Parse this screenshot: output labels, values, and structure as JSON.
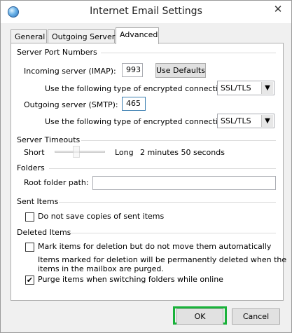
{
  "window": {
    "title": "Internet Email Settings",
    "close_glyph": "✕"
  },
  "tabs": [
    {
      "label": "General"
    },
    {
      "label": "Outgoing Server"
    },
    {
      "label": "Advanced"
    }
  ],
  "server_ports": {
    "heading": "Server Port Numbers",
    "incoming_label": "Incoming server (IMAP):",
    "incoming_value": "993",
    "use_defaults_label": "Use Defaults",
    "encryption_label": "Use the following type of encrypted connection:",
    "incoming_encryption": "SSL/TLS",
    "outgoing_label": "Outgoing server (SMTP):",
    "outgoing_value": "465",
    "outgoing_encryption": "SSL/TLS"
  },
  "timeouts": {
    "heading": "Server Timeouts",
    "short_label": "Short",
    "long_label": "Long",
    "value_text": "2 minutes 50 seconds",
    "level": 0.4
  },
  "folders": {
    "heading": "Folders",
    "root_path_label": "Root folder path:",
    "root_path_value": ""
  },
  "sent_items": {
    "heading": "Sent Items",
    "no_copies_label": "Do not save copies of sent items",
    "no_copies_checked": false
  },
  "deleted_items": {
    "heading": "Deleted Items",
    "mark_label": "Mark items for deletion but do not move them automatically",
    "mark_checked": false,
    "note_line1": "Items marked for deletion will be permanently deleted when the",
    "note_line2": "items in the mailbox are purged.",
    "purge_label": "Purge items when switching folders while online",
    "purge_checked": true
  },
  "buttons": {
    "ok_label": "OK",
    "cancel_label": "Cancel"
  },
  "colors": {
    "highlight": "#19b23a",
    "focus_border": "#3c7fb1"
  }
}
